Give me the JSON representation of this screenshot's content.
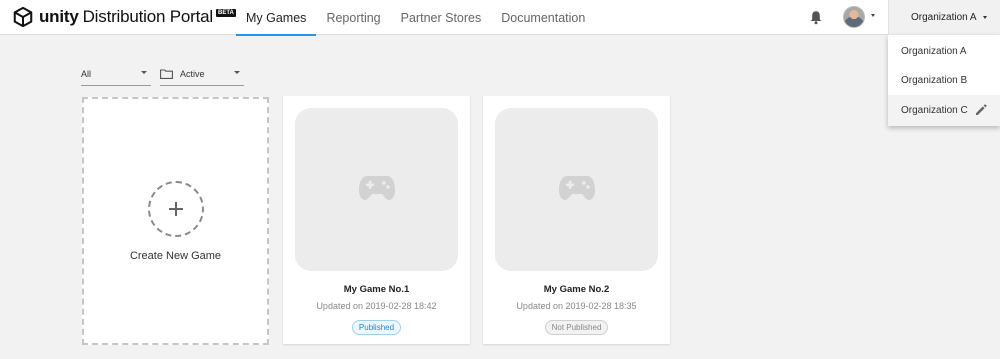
{
  "header": {
    "brand": "unity",
    "product": "Distribution Portal",
    "beta_badge": "BETA",
    "tabs": [
      {
        "label": "My Games",
        "active": true
      },
      {
        "label": "Reporting",
        "active": false
      },
      {
        "label": "Partner Stores",
        "active": false
      },
      {
        "label": "Documentation",
        "active": false
      }
    ],
    "icons": [
      "unity-logo-icon",
      "bell-icon",
      "avatar",
      "chevron-down-icon"
    ],
    "org_selector": "Organization A"
  },
  "org_menu": {
    "items": [
      {
        "label": "Organization A"
      },
      {
        "label": "Organization B"
      },
      {
        "label": "Organization C",
        "selected": true,
        "icon": "pencil-icon"
      }
    ]
  },
  "filters": {
    "platform": "All",
    "status": "Active",
    "status_icon": "folder-icon"
  },
  "create_card": {
    "label": "Create New Game",
    "icon": "plus-icon"
  },
  "games": [
    {
      "title": "My Game No.1",
      "updated": "Updated on 2019-02-28 18:42",
      "status": "Published"
    },
    {
      "title": "My Game No.2",
      "updated": "Updated on 2019-02-28 18:35",
      "status": "Not Published"
    }
  ],
  "colors": {
    "accent": "#2196f3",
    "published": "#1e88c8",
    "background": "#f2f2f2"
  }
}
